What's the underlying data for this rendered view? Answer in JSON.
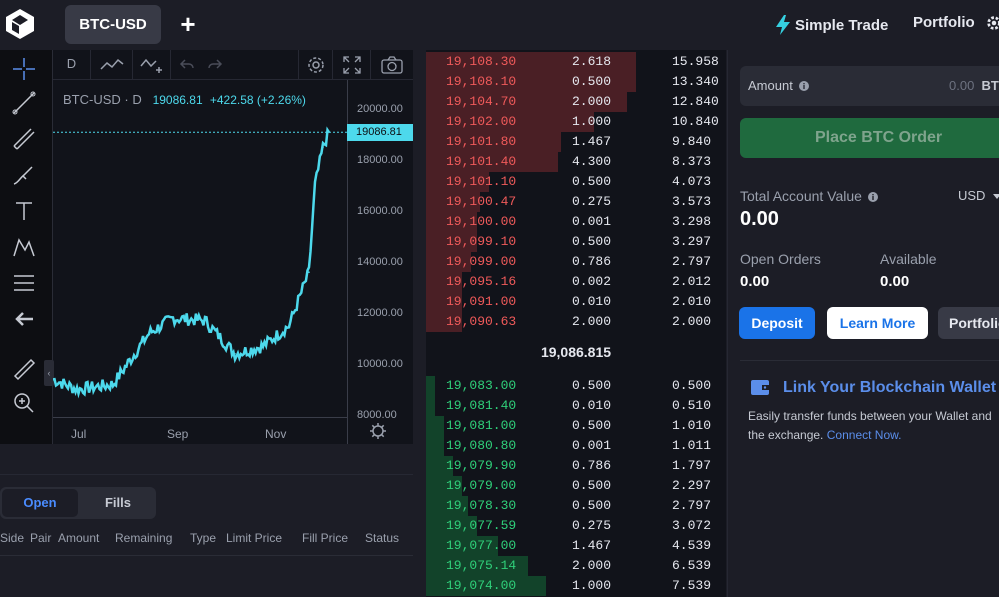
{
  "header": {
    "market_tab": "BTC-USD",
    "add_symbol": "+",
    "simple_trade": "Simple Trade",
    "portfolio": "Portfolio"
  },
  "chart": {
    "toolbar": {
      "interval": "D"
    },
    "legend_symbol": "BTC-USD · D",
    "legend_price": "19086.81",
    "legend_change": "+422.58 (+2.26%)",
    "last_price_tag": "19086.81",
    "price_ticks": [
      "20000.00",
      "18000.00",
      "16000.00",
      "14000.00",
      "12000.00",
      "10000.00",
      "8000.00"
    ],
    "time_ticks": [
      "Jul",
      "Sep",
      "Nov"
    ],
    "collapse_glyph": "‹",
    "colors": {
      "line": "#4dd9ec",
      "bg": "#11131a"
    }
  },
  "chart_data": {
    "type": "line",
    "x": [
      "Jun 15",
      "Jul 1",
      "Jul 15",
      "Aug 1",
      "Aug 15",
      "Sep 1",
      "Sep 15",
      "Oct 1",
      "Oct 15",
      "Nov 1",
      "Nov 15",
      "Nov 22",
      "Dec 1"
    ],
    "values": [
      9400,
      9000,
      9200,
      11200,
      11800,
      11700,
      10400,
      10700,
      11500,
      13600,
      17000,
      18500,
      19086
    ],
    "ylim": [
      8000,
      20500
    ]
  },
  "orders": {
    "tabs": [
      "Open",
      "Fills"
    ],
    "columns": [
      "Side",
      "Pair",
      "Amount",
      "Remaining",
      "Type",
      "Limit Price",
      "Fill Price",
      "Status"
    ]
  },
  "orderbook": {
    "asks": [
      {
        "price": "19,108.30",
        "size": "2.618",
        "total": "15.958",
        "depth": 0.7
      },
      {
        "price": "19,108.10",
        "size": "0.500",
        "total": "13.340",
        "depth": 0.7
      },
      {
        "price": "19,104.70",
        "size": "2.000",
        "total": "12.840",
        "depth": 0.67
      },
      {
        "price": "19,102.00",
        "size": "1.000",
        "total": "10.840",
        "depth": 0.56
      },
      {
        "price": "19,101.80",
        "size": "1.467",
        "total": "9.840",
        "depth": 0.45
      },
      {
        "price": "19,101.40",
        "size": "4.300",
        "total": "8.373",
        "depth": 0.44
      },
      {
        "price": "19,101.10",
        "size": "0.500",
        "total": "4.073",
        "depth": 0.21
      },
      {
        "price": "19,100.47",
        "size": "0.275",
        "total": "3.573",
        "depth": 0.18
      },
      {
        "price": "19,100.00",
        "size": "0.001",
        "total": "3.298",
        "depth": 0.17
      },
      {
        "price": "19,099.10",
        "size": "0.500",
        "total": "3.297",
        "depth": 0.17
      },
      {
        "price": "19,099.00",
        "size": "0.786",
        "total": "2.797",
        "depth": 0.15
      },
      {
        "price": "19,095.16",
        "size": "0.002",
        "total": "2.012",
        "depth": 0.12
      },
      {
        "price": "19,091.00",
        "size": "0.010",
        "total": "2.010",
        "depth": 0.12
      },
      {
        "price": "19,090.63",
        "size": "2.000",
        "total": "2.000",
        "depth": 0.12
      }
    ],
    "mid_price": "19,086.815",
    "bids": [
      {
        "price": "19,083.00",
        "size": "0.500",
        "total": "0.500",
        "depth": 0.03
      },
      {
        "price": "19,081.40",
        "size": "0.010",
        "total": "0.510",
        "depth": 0.03
      },
      {
        "price": "19,081.00",
        "size": "0.500",
        "total": "1.010",
        "depth": 0.06
      },
      {
        "price": "19,080.80",
        "size": "0.001",
        "total": "1.011",
        "depth": 0.06
      },
      {
        "price": "19,079.90",
        "size": "0.786",
        "total": "1.797",
        "depth": 0.09
      },
      {
        "price": "19,079.00",
        "size": "0.500",
        "total": "2.297",
        "depth": 0.12
      },
      {
        "price": "19,078.30",
        "size": "0.500",
        "total": "2.797",
        "depth": 0.14
      },
      {
        "price": "19,077.59",
        "size": "0.275",
        "total": "3.072",
        "depth": 0.17
      },
      {
        "price": "19,077.00",
        "size": "1.467",
        "total": "4.539",
        "depth": 0.24
      },
      {
        "price": "19,075.14",
        "size": "2.000",
        "total": "6.539",
        "depth": 0.34
      },
      {
        "price": "19,074.00",
        "size": "1.000",
        "total": "7.539",
        "depth": 0.4
      }
    ]
  },
  "trade_panel": {
    "amount_label": "Amount",
    "amount_placeholder": "0.00",
    "amount_currency": "BTC",
    "place_order": "Place BTC Order",
    "total_account_label": "Total Account Value",
    "currency_select": "USD",
    "total_account_value": "0.00",
    "open_orders_label": "Open Orders",
    "open_orders_value": "0.00",
    "available_label": "Available",
    "available_value": "0.00",
    "deposit": "Deposit",
    "learn_more": "Learn More",
    "portfolio_btn": "Portfolio",
    "link_title": "Link Your Blockchain Wallet",
    "link_desc_1": "Easily transfer funds between your Wallet and",
    "link_desc_2": "the exchange.",
    "connect_now": "Connect Now."
  }
}
